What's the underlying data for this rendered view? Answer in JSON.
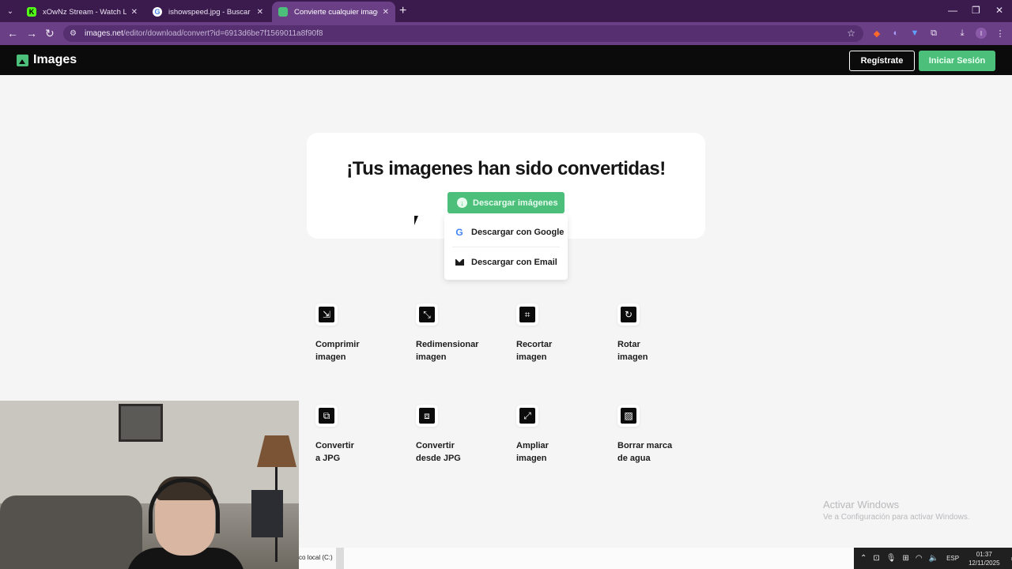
{
  "browser": {
    "tabs": [
      {
        "title": "xOwNz Stream - Watch Live on",
        "favicon": "kick-icon",
        "active": false
      },
      {
        "title": "ishowspeed.jpg - Buscar con G",
        "favicon": "google-icon",
        "active": false
      },
      {
        "title": "Convierte cualquier imagen a JP",
        "favicon": "images-icon",
        "active": true
      }
    ],
    "url_host": "images.net",
    "url_path": "/editor/download/convert?id=6913d6be7f1569011a8f90f8"
  },
  "site": {
    "logo": "Images",
    "register_label": "Regístrate",
    "login_label": "Iniciar Sesión",
    "accent_color": "#4cc07a"
  },
  "card": {
    "title": "¡Tus imagenes han sido convertidas!",
    "download_button": "Descargar imágenes"
  },
  "dropdown": {
    "google": "Descargar con Google",
    "email": "Descargar con Email"
  },
  "tools": [
    {
      "label": "Comprimir\nimagen",
      "icon": "compress-icon"
    },
    {
      "label": "Redimensionar\nimagen",
      "icon": "resize-icon"
    },
    {
      "label": "Recortar\nimagen",
      "icon": "crop-icon"
    },
    {
      "label": "Rotar\nimagen",
      "icon": "rotate-icon"
    },
    {
      "label": "Convertir\na JPG",
      "icon": "convert-to-jpg-icon"
    },
    {
      "label": "Convertir\ndesde JPG",
      "icon": "convert-from-jpg-icon"
    },
    {
      "label": "Ampliar\nimagen",
      "icon": "upscale-icon"
    },
    {
      "label": "Borrar marca\nde agua",
      "icon": "watermark-remove-icon"
    }
  ],
  "windows": {
    "activate_title": "Activar Windows",
    "activate_sub": "Ve a Configuración para activar Windows.",
    "taskbar_drive": "co local (C:)",
    "lang": "ESP",
    "time": "01:37",
    "date": "12/11/2025",
    "notifications": "3"
  }
}
